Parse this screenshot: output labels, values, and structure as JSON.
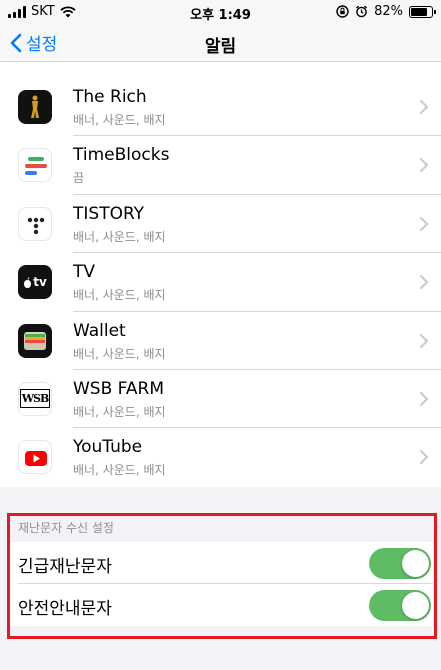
{
  "status": {
    "carrier": "SKT",
    "time": "오후 1:49",
    "battery": "82%",
    "battery_level": 0.82
  },
  "nav": {
    "back_label": "설정",
    "title": "알림"
  },
  "apps": [
    {
      "name": "The Rich",
      "sub": "배너, 사운드, 배지",
      "icon": "the-rich-icon"
    },
    {
      "name": "TimeBlocks",
      "sub": "끔",
      "icon": "timeblocks-icon"
    },
    {
      "name": "TISTORY",
      "sub": "배너, 사운드, 배지",
      "icon": "tistory-icon"
    },
    {
      "name": "TV",
      "sub": "배너, 사운드, 배지",
      "icon": "apple-tv-icon"
    },
    {
      "name": "Wallet",
      "sub": "배너, 사운드, 배지",
      "icon": "wallet-icon"
    },
    {
      "name": "WSB FARM",
      "sub": "배너, 사운드, 배지",
      "icon": "wsb-farm-icon"
    },
    {
      "name": "YouTube",
      "sub": "배너, 사운드, 배지",
      "icon": "youtube-icon"
    }
  ],
  "tv_logo_text": "tv",
  "wsb_logo_text": "WSB",
  "section": {
    "header": "재난문자 수신 설정",
    "toggles": [
      {
        "label": "긴급재난문자",
        "on": true
      },
      {
        "label": "안전안내문자",
        "on": true
      }
    ]
  },
  "colors": {
    "accent": "#007aff",
    "toggle_on": "#5dbc64",
    "highlight": "#e11b22"
  }
}
